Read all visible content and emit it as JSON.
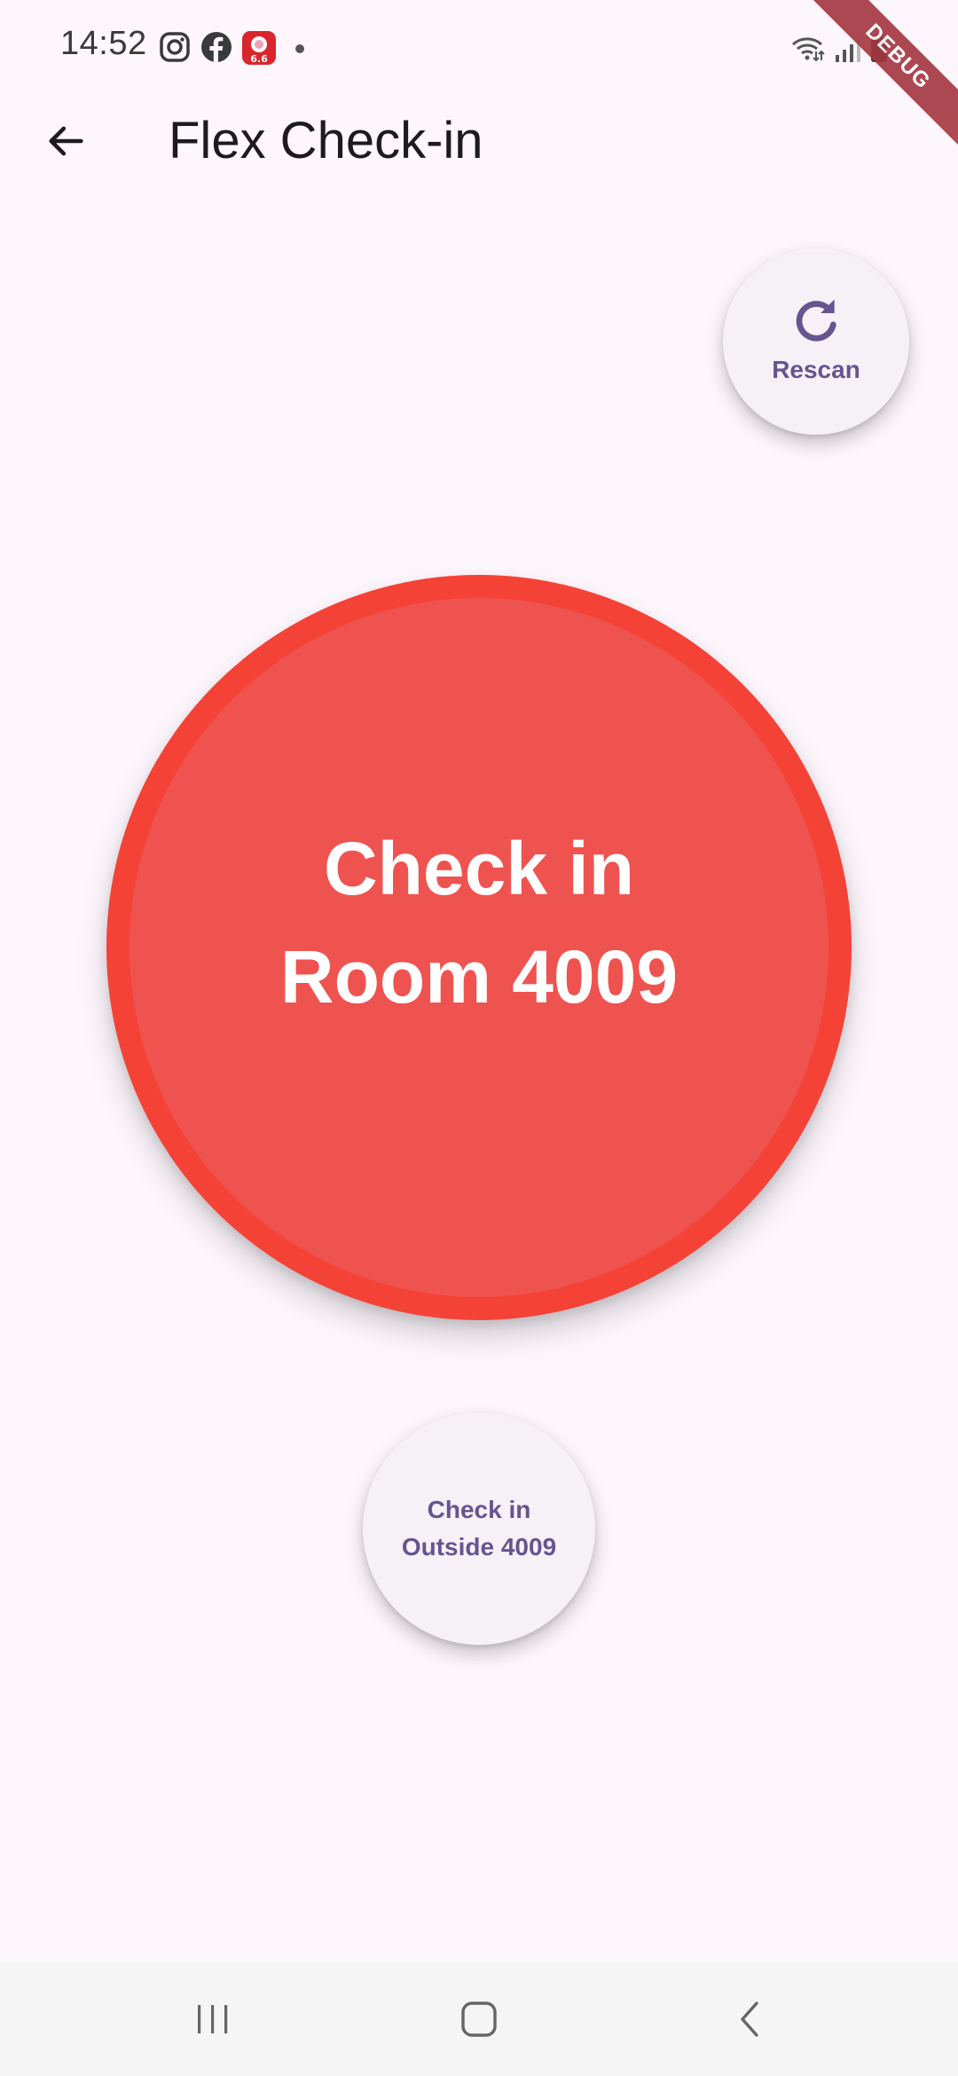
{
  "status_bar": {
    "time": "14:52",
    "icons": [
      "instagram-icon",
      "facebook-icon",
      "app-notification-icon",
      "notification-dot"
    ],
    "right_icons": [
      "wifi-icon",
      "signal-icon",
      "battery-icon"
    ]
  },
  "debug_banner": {
    "label": "DEBUG"
  },
  "app_bar": {
    "back_icon": "arrow-back-icon",
    "title": "Flex Check-in"
  },
  "rescan": {
    "icon": "refresh-icon",
    "label": "Rescan"
  },
  "main_checkin": {
    "line1": "Check in",
    "line2": "Room 4009"
  },
  "outside_checkin": {
    "line1": "Check in",
    "line2": "Outside 4009"
  },
  "nav_bar": {
    "buttons": [
      "recent-apps-icon",
      "home-icon",
      "back-icon"
    ]
  },
  "colors": {
    "background": "#fdf7fd",
    "main_button_ring": "#f44236",
    "main_button_fill": "#ef5350",
    "secondary_button": "#f5f1f7",
    "accent_text": "#65558f",
    "debug_banner": "#a4363f"
  }
}
